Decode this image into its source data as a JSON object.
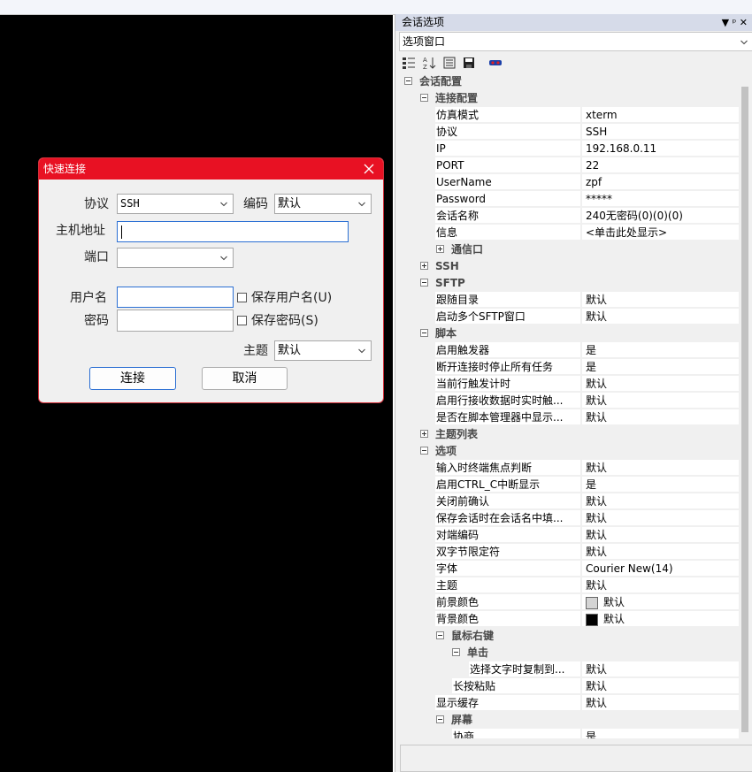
{
  "dialog": {
    "title": "快速连接",
    "protocol_label": "协议",
    "protocol_value": "SSH",
    "encoding_label": "编码",
    "encoding_value": "默认",
    "host_label": "主机地址",
    "port_label": "端口",
    "username_label": "用户名",
    "save_username_label": "保存用户名(U)",
    "password_label": "密码",
    "save_password_label": "保存密码(S)",
    "theme_label": "主题",
    "theme_value": "默认",
    "connect_label": "连接",
    "cancel_label": "取消"
  },
  "panel": {
    "title": "会话选项",
    "pin_glyph": "▼ ᵖ ✕",
    "selector_value": "选项窗口",
    "rows": [
      {
        "kind": "cat",
        "level": 0,
        "name": "会话配置",
        "expanded": true
      },
      {
        "kind": "cat",
        "level": 1,
        "name": "连接配置",
        "expanded": true
      },
      {
        "kind": "prop",
        "level": 2,
        "name": "仿真模式",
        "value": "xterm"
      },
      {
        "kind": "prop",
        "level": 2,
        "name": "协议",
        "value": "SSH"
      },
      {
        "kind": "prop",
        "level": 2,
        "name": "IP",
        "value": "192.168.0.11"
      },
      {
        "kind": "prop",
        "level": 2,
        "name": "PORT",
        "value": "22"
      },
      {
        "kind": "prop",
        "level": 2,
        "name": "UserName",
        "value": "zpf"
      },
      {
        "kind": "prop",
        "level": 2,
        "name": "Password",
        "value": "*****"
      },
      {
        "kind": "prop",
        "level": 2,
        "name": "会话名称",
        "value": "240无密码(0)(0)(0)"
      },
      {
        "kind": "prop",
        "level": 2,
        "name": "信息",
        "value": "<单击此处显示>"
      },
      {
        "kind": "cat",
        "level": 2,
        "name": "通信口",
        "expanded": false
      },
      {
        "kind": "cat",
        "level": 1,
        "name": "SSH",
        "expanded": false
      },
      {
        "kind": "cat",
        "level": 1,
        "name": "SFTP",
        "expanded": true
      },
      {
        "kind": "prop",
        "level": 2,
        "name": "跟随目录",
        "value": "默认"
      },
      {
        "kind": "prop",
        "level": 2,
        "name": "启动多个SFTP窗口",
        "value": "默认"
      },
      {
        "kind": "cat",
        "level": 1,
        "name": "脚本",
        "expanded": true
      },
      {
        "kind": "prop",
        "level": 2,
        "name": "启用触发器",
        "value": "是"
      },
      {
        "kind": "prop",
        "level": 2,
        "name": "断开连接时停止所有任务",
        "value": "是"
      },
      {
        "kind": "prop",
        "level": 2,
        "name": "当前行触发计时",
        "value": "默认"
      },
      {
        "kind": "prop",
        "level": 2,
        "name": "启用行接收数据时实时触...",
        "value": "默认"
      },
      {
        "kind": "prop",
        "level": 2,
        "name": "是否在脚本管理器中显示...",
        "value": "默认"
      },
      {
        "kind": "cat",
        "level": 1,
        "name": "主题列表",
        "expanded": false
      },
      {
        "kind": "cat",
        "level": 1,
        "name": "选项",
        "expanded": true
      },
      {
        "kind": "prop",
        "level": 2,
        "name": "输入时终端焦点判断",
        "value": "默认"
      },
      {
        "kind": "prop",
        "level": 2,
        "name": "启用CTRL_C中断显示",
        "value": "是"
      },
      {
        "kind": "prop",
        "level": 2,
        "name": "关闭前确认",
        "value": "默认"
      },
      {
        "kind": "prop",
        "level": 2,
        "name": "保存会话时在会话名中填...",
        "value": "默认"
      },
      {
        "kind": "prop",
        "level": 2,
        "name": "对端编码",
        "value": "默认"
      },
      {
        "kind": "prop",
        "level": 2,
        "name": "双字节限定符",
        "value": "默认"
      },
      {
        "kind": "prop",
        "level": 2,
        "name": "字体",
        "value": "Courier New(14)"
      },
      {
        "kind": "prop",
        "level": 2,
        "name": "主题",
        "value": "默认"
      },
      {
        "kind": "prop",
        "level": 2,
        "name": "前景颜色",
        "value": "默认",
        "swatch": "#d4d4d4"
      },
      {
        "kind": "prop",
        "level": 2,
        "name": "背景颜色",
        "value": "默认",
        "swatch": "#000000"
      },
      {
        "kind": "cat",
        "level": 2,
        "name": "鼠标右键",
        "expanded": true
      },
      {
        "kind": "cat",
        "level": 3,
        "name": "单击",
        "expanded": true
      },
      {
        "kind": "prop",
        "level": 4,
        "name": "选择文字时复制到...",
        "value": "默认"
      },
      {
        "kind": "prop",
        "level": 3,
        "name": "长按粘贴",
        "value": "默认"
      },
      {
        "kind": "prop",
        "level": 2,
        "name": "显示缓存",
        "value": "默认"
      },
      {
        "kind": "cat",
        "level": 2,
        "name": "屏幕",
        "expanded": true
      },
      {
        "kind": "prop",
        "level": 3,
        "name": "协商",
        "value": "是"
      }
    ]
  },
  "colors": {
    "dialog_title": "#e81123",
    "terminal": "#000000",
    "focus": "#2b6fd3"
  }
}
